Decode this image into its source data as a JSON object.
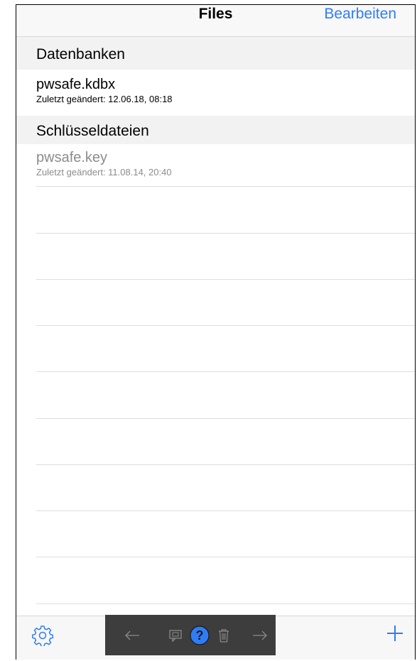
{
  "navbar": {
    "title": "Files",
    "edit_label": "Bearbeiten"
  },
  "sections": {
    "databases": {
      "header": "Datenbanken",
      "items": [
        {
          "name": "pwsafe.kdbx",
          "modified": "Zuletzt geändert: 12.06.18, 08:18"
        }
      ]
    },
    "keyfiles": {
      "header": "Schlüsseldateien",
      "items": [
        {
          "name": "pwsafe.key",
          "modified": "Zuletzt geändert: 11.08.14, 20:40"
        }
      ]
    }
  },
  "toolbar": {
    "left_icon": "gear-icon",
    "right_icon": "plus-icon"
  },
  "overlay": {
    "icons": [
      "arrow-left-icon",
      "comment-icon",
      "help-icon",
      "trash-icon",
      "arrow-right-icon"
    ]
  },
  "colors": {
    "accent": "#2f7cf6",
    "overlay_bg": "#3d3d3d",
    "disabled_text": "#8c8c8c"
  }
}
